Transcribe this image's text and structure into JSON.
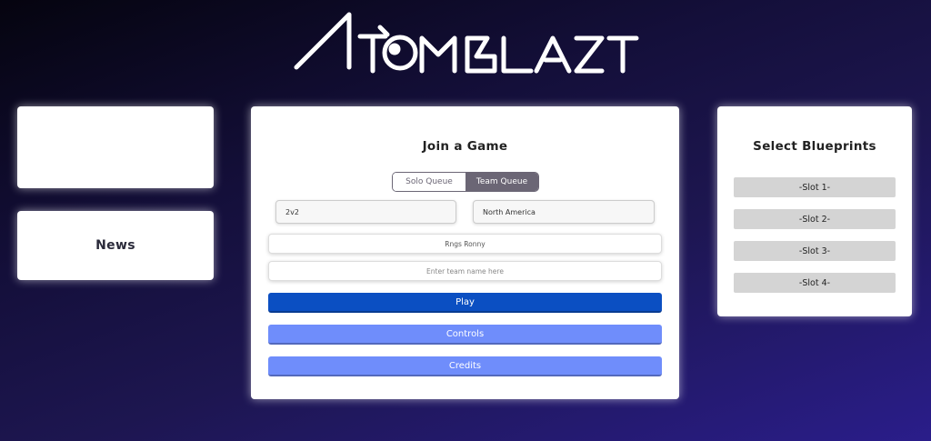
{
  "logo": {
    "text": "ATOMBLAST"
  },
  "news": {
    "title": "News"
  },
  "join": {
    "title": "Join a Game",
    "queue": {
      "solo_label": "Solo Queue",
      "team_label": "Team Queue",
      "selected": "Team Queue"
    },
    "mode_value": "2v2",
    "region_value": "North America",
    "name_value": "Rngs Ronny",
    "team_placeholder": "Enter team name here",
    "play_label": "Play",
    "controls_label": "Controls",
    "credits_label": "Credits"
  },
  "blueprints": {
    "title": "Select Blueprints",
    "slots": [
      "-Slot 1-",
      "-Slot 2-",
      "-Slot 3-",
      "-Slot 4-"
    ]
  }
}
